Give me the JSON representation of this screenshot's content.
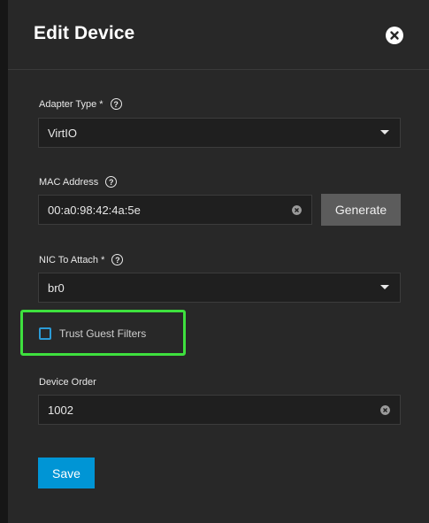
{
  "dialog": {
    "title": "Edit Device"
  },
  "adapter_type": {
    "label": "Adapter Type *",
    "value": "VirtIO"
  },
  "mac_address": {
    "label": "MAC Address",
    "value": "00:a0:98:42:4a:5e",
    "generate_label": "Generate"
  },
  "nic_to_attach": {
    "label": "NIC To Attach *",
    "value": "br0"
  },
  "trust_guest_filters": {
    "label": "Trust Guest Filters",
    "checked": false
  },
  "device_order": {
    "label": "Device Order",
    "value": "1002"
  },
  "actions": {
    "save_label": "Save"
  },
  "icons": {
    "help": "?",
    "close": "close-icon",
    "clear": "clear-icon",
    "caret": "chevron-down-icon"
  },
  "colors": {
    "primary": "#0095d5",
    "checkbox_border": "#2b9bd6",
    "highlight": "#3ee03e",
    "panel_bg": "#282828",
    "field_bg": "#1f1f1f",
    "generate_bg": "#5c5c5c"
  }
}
